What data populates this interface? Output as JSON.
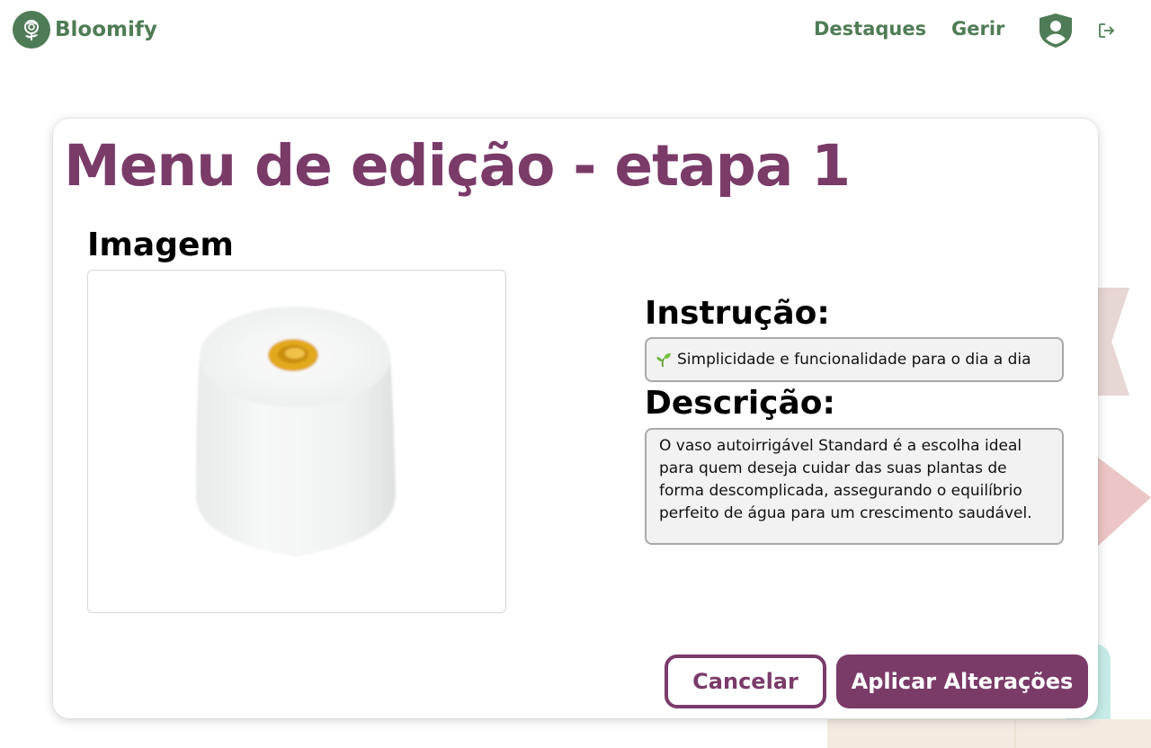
{
  "header": {
    "brand_name": "Bloomify",
    "nav": {
      "destaques": "Destaques",
      "gerir": "Gerir"
    }
  },
  "editor": {
    "title": "Menu de edição - etapa 1",
    "image_label": "Imagem",
    "instrucao_label": "Instrução:",
    "instrucao_value": "Simplicidade e funcionalidade para o dia a dia",
    "descricao_label": "Descrição:",
    "descricao_value": "O vaso autoirrigável Standard é a escolha ideal para quem deseja cuidar das suas plantas de forma descomplicada, assegurando o equilíbrio perfeito de água para um crescimento saudável.",
    "cancel_label": "Cancelar",
    "apply_label": "Aplicar Alterações"
  },
  "icons": {
    "logo": "flower-logo-icon",
    "profile": "user-shield-icon",
    "logout": "logout-icon",
    "seedling": "seedling-icon",
    "product_image": "yarn-spool-image"
  },
  "colors": {
    "brand_green": "#4f7c56",
    "accent_purple": "#7a3b69",
    "input_bg": "#f2f2f2",
    "input_border": "#a9a9a9"
  }
}
